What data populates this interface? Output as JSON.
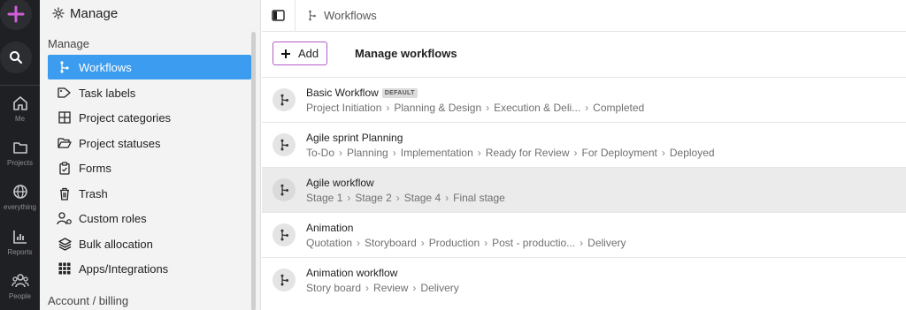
{
  "rail": {
    "items": [
      {
        "label": "Me",
        "icon": "home-icon"
      },
      {
        "label": "Projects",
        "icon": "folder-icon"
      },
      {
        "label": "everything",
        "icon": "globe-icon"
      },
      {
        "label": "Reports",
        "icon": "bar-chart-icon"
      },
      {
        "label": "People",
        "icon": "people-icon"
      }
    ],
    "accent": "#d05fd9"
  },
  "sidebar": {
    "title": "Manage",
    "section_manage": "Manage",
    "section_account": "Account / billing",
    "items": [
      {
        "label": "Workflows",
        "icon": "workflow-icon",
        "active": true
      },
      {
        "label": "Task labels",
        "icon": "tag-icon"
      },
      {
        "label": "Project categories",
        "icon": "grid-icon"
      },
      {
        "label": "Project statuses",
        "icon": "folder-open-icon"
      },
      {
        "label": "Forms",
        "icon": "clipboard-icon"
      },
      {
        "label": "Trash",
        "icon": "trash-icon"
      },
      {
        "label": "Custom roles",
        "icon": "user-gear-icon"
      },
      {
        "label": "Bulk allocation",
        "icon": "layers-icon"
      },
      {
        "label": "Apps/Integrations",
        "icon": "apps-grid-icon"
      }
    ],
    "active_color": "#3c9cf0"
  },
  "topbar": {
    "breadcrumb": "Workflows"
  },
  "main": {
    "add_label": "Add",
    "title": "Manage workflows",
    "workflows": [
      {
        "name": "Basic Workflow",
        "badge": "DEFAULT",
        "stages": [
          "Project Initiation",
          "Planning & Design",
          "Execution & Deli...",
          "Completed"
        ]
      },
      {
        "name": "Agile sprint Planning",
        "badge": "",
        "stages": [
          "To-Do",
          "Planning",
          "Implementation",
          "Ready for Review",
          "For Deployment",
          "Deployed"
        ]
      },
      {
        "name": "Agile workflow",
        "badge": "",
        "stages": [
          "Stage 1",
          "Stage 2",
          "Stage 4",
          "Final stage"
        ],
        "selected": true
      },
      {
        "name": "Animation",
        "badge": "",
        "stages": [
          "Quotation",
          "Storyboard",
          "Production",
          "Post - productio...",
          "Delivery"
        ]
      },
      {
        "name": "Animation workflow",
        "badge": "",
        "stages": [
          "Story board",
          "Review",
          "Delivery"
        ]
      }
    ]
  }
}
